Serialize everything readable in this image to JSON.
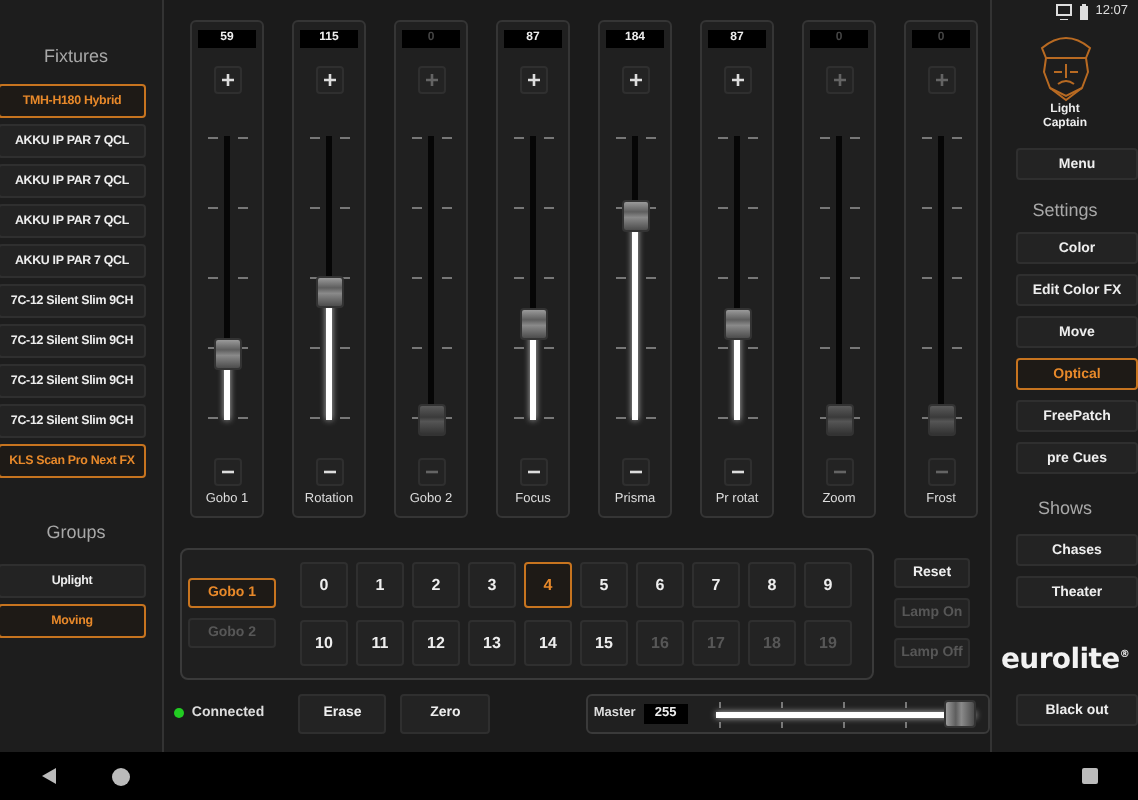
{
  "status_bar": {
    "time": "12:07"
  },
  "fixtures": {
    "title": "Fixtures",
    "items": [
      {
        "label": "TMH-H180 Hybrid",
        "selected": true
      },
      {
        "label": "AKKU IP PAR 7 QCL",
        "selected": false
      },
      {
        "label": "AKKU IP PAR 7 QCL",
        "selected": false
      },
      {
        "label": "AKKU IP PAR 7 QCL",
        "selected": false
      },
      {
        "label": "AKKU IP PAR 7 QCL",
        "selected": false
      },
      {
        "label": "7C-12 Silent Slim 9CH",
        "selected": false
      },
      {
        "label": "7C-12 Silent Slim 9CH",
        "selected": false
      },
      {
        "label": "7C-12 Silent Slim 9CH",
        "selected": false
      },
      {
        "label": "7C-12 Silent Slim 9CH",
        "selected": false
      },
      {
        "label": "KLS Scan Pro Next FX",
        "selected": true
      }
    ]
  },
  "groups": {
    "title": "Groups",
    "items": [
      {
        "label": "Uplight",
        "selected": false
      },
      {
        "label": "Moving",
        "selected": true
      }
    ]
  },
  "channels": [
    {
      "value": "59",
      "name": "Gobo 1",
      "level": 0.23,
      "disabled": false
    },
    {
      "value": "115",
      "name": "Rotation",
      "level": 0.45,
      "disabled": false
    },
    {
      "value": "0",
      "name": "Gobo 2",
      "level": 0,
      "disabled": true
    },
    {
      "value": "87",
      "name": "Focus",
      "level": 0.34,
      "disabled": false
    },
    {
      "value": "184",
      "name": "Prisma",
      "level": 0.72,
      "disabled": false
    },
    {
      "value": "87",
      "name": "Pr rotat",
      "level": 0.34,
      "disabled": false
    },
    {
      "value": "0",
      "name": "Zoom",
      "level": 0,
      "disabled": true
    },
    {
      "value": "0",
      "name": "Frost",
      "level": 0,
      "disabled": true
    }
  ],
  "gobo_panel": {
    "gobos": [
      {
        "label": "Gobo 1",
        "selected": true,
        "disabled": false
      },
      {
        "label": "Gobo 2",
        "selected": false,
        "disabled": true
      }
    ],
    "slots": [
      {
        "label": "0",
        "selected": false,
        "disabled": false
      },
      {
        "label": "1",
        "selected": false,
        "disabled": false
      },
      {
        "label": "2",
        "selected": false,
        "disabled": false
      },
      {
        "label": "3",
        "selected": false,
        "disabled": false
      },
      {
        "label": "4",
        "selected": true,
        "disabled": false
      },
      {
        "label": "5",
        "selected": false,
        "disabled": false
      },
      {
        "label": "6",
        "selected": false,
        "disabled": false
      },
      {
        "label": "7",
        "selected": false,
        "disabled": false
      },
      {
        "label": "8",
        "selected": false,
        "disabled": false
      },
      {
        "label": "9",
        "selected": false,
        "disabled": false
      },
      {
        "label": "10",
        "selected": false,
        "disabled": false
      },
      {
        "label": "11",
        "selected": false,
        "disabled": false
      },
      {
        "label": "12",
        "selected": false,
        "disabled": false
      },
      {
        "label": "13",
        "selected": false,
        "disabled": false
      },
      {
        "label": "14",
        "selected": false,
        "disabled": false
      },
      {
        "label": "15",
        "selected": false,
        "disabled": false
      },
      {
        "label": "16",
        "selected": false,
        "disabled": true
      },
      {
        "label": "17",
        "selected": false,
        "disabled": true
      },
      {
        "label": "18",
        "selected": false,
        "disabled": true
      },
      {
        "label": "19",
        "selected": false,
        "disabled": true
      }
    ],
    "actions": [
      {
        "label": "Reset",
        "disabled": false
      },
      {
        "label": "Lamp On",
        "disabled": true
      },
      {
        "label": "Lamp Off",
        "disabled": true
      }
    ]
  },
  "footer": {
    "status": {
      "label": "Connected",
      "connected": true
    },
    "buttons": [
      {
        "label": "Erase"
      },
      {
        "label": "Zero"
      }
    ],
    "master": {
      "label": "Master",
      "value": "255",
      "level": 1
    }
  },
  "right_panel": {
    "brand": "Light Captain",
    "menu": "Menu",
    "settings": {
      "title": "Settings",
      "items": [
        {
          "label": "Color",
          "selected": false
        },
        {
          "label": "Edit Color FX",
          "selected": false
        },
        {
          "label": "Move",
          "selected": false
        },
        {
          "label": "Optical",
          "selected": true
        },
        {
          "label": "FreePatch",
          "selected": false
        },
        {
          "label": "pre Cues",
          "selected": false
        }
      ]
    },
    "shows": {
      "title": "Shows",
      "items": [
        {
          "label": "Chases"
        },
        {
          "label": "Theater"
        }
      ]
    },
    "logo": "eurolite$^{®}$",
    "blackout": "Black out"
  }
}
